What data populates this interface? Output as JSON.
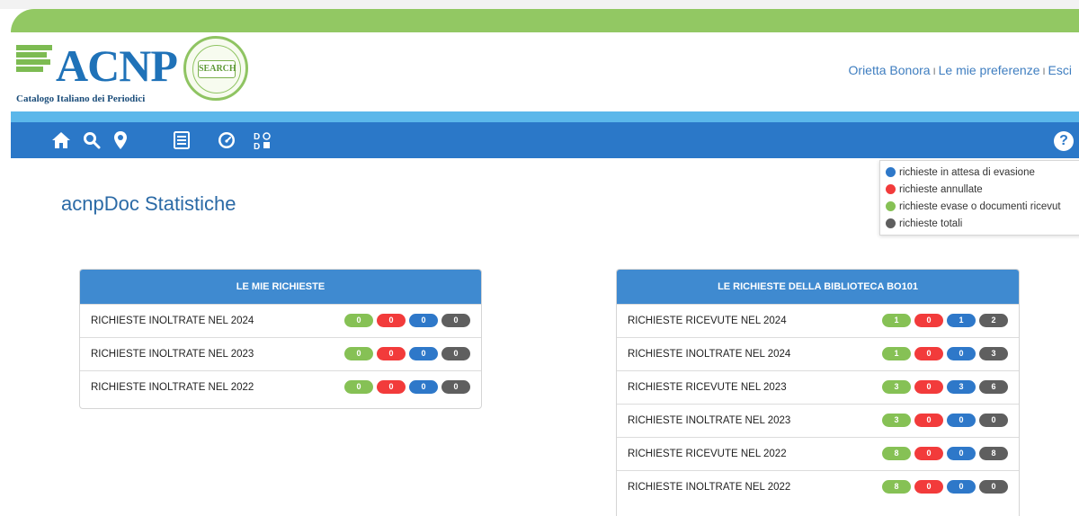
{
  "header": {
    "logo_word": "ACNP",
    "logo_subtitle": "Catalogo Italiano dei Periodici",
    "seal_text": "SEARCH",
    "user_name": "Orietta Bonora",
    "preferences": "Le mie preferenze",
    "logout": "Esci",
    "separator": "I"
  },
  "nav": {
    "icons": [
      "home-icon",
      "search-icon",
      "location-pin-icon",
      "list-icon",
      "dashboard-icon",
      "dodo-icon"
    ],
    "help_label": "?"
  },
  "legend": {
    "items": [
      {
        "label": "richieste in attesa di evasione",
        "color": "#2e78c9"
      },
      {
        "label": "richieste annullate",
        "color": "#f23b3b"
      },
      {
        "label": "richieste evase o documenti ricevut",
        "color": "#86c155"
      },
      {
        "label": "richieste totali",
        "color": "#5f5f5f"
      }
    ]
  },
  "page_title": "acnpDoc Statistiche",
  "panel_mine": {
    "title": "LE MIE RICHIESTE",
    "rows": [
      {
        "label": "RICHIESTE INOLTRATE NEL 2024",
        "green": "0",
        "red": "0",
        "blue": "0",
        "gray": "0"
      },
      {
        "label": "RICHIESTE INOLTRATE NEL 2023",
        "green": "0",
        "red": "0",
        "blue": "0",
        "gray": "0"
      },
      {
        "label": "RICHIESTE INOLTRATE NEL 2022",
        "green": "0",
        "red": "0",
        "blue": "0",
        "gray": "0"
      }
    ]
  },
  "panel_library": {
    "title": "LE RICHIESTE DELLA BIBLIOTECA BO101",
    "rows": [
      {
        "label": "RICHIESTE RICEVUTE NEL 2024",
        "green": "1",
        "red": "0",
        "blue": "1",
        "gray": "2"
      },
      {
        "label": "RICHIESTE INOLTRATE NEL 2024",
        "green": "1",
        "red": "0",
        "blue": "0",
        "gray": "3"
      },
      {
        "label": "RICHIESTE RICEVUTE NEL 2023",
        "green": "3",
        "red": "0",
        "blue": "3",
        "gray": "6"
      },
      {
        "label": "RICHIESTE INOLTRATE NEL 2023",
        "green": "3",
        "red": "0",
        "blue": "0",
        "gray": "0"
      },
      {
        "label": "RICHIESTE RICEVUTE NEL 2022",
        "green": "8",
        "red": "0",
        "blue": "0",
        "gray": "8"
      },
      {
        "label": "RICHIESTE INOLTRATE NEL 2022",
        "green": "8",
        "red": "0",
        "blue": "0",
        "gray": "0"
      }
    ]
  }
}
